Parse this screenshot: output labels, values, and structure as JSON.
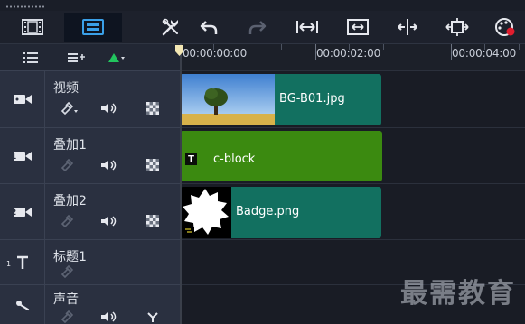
{
  "ruler": {
    "timecodes": [
      "00:00:00:00",
      "00:00:02:00",
      "00:00:04:00"
    ]
  },
  "tracks": [
    {
      "name": "视频",
      "type": "video",
      "clip": {
        "label": "BG-B01.jpg",
        "kind": "image"
      }
    },
    {
      "name": "叠加1",
      "type": "overlay",
      "badge": "1",
      "clip": {
        "label": "c-block",
        "kind": "title"
      }
    },
    {
      "name": "叠加2",
      "type": "overlay",
      "badge": "2",
      "clip": {
        "label": "Badge.png",
        "kind": "image"
      }
    },
    {
      "name": "标题1",
      "type": "title",
      "badge": "1"
    },
    {
      "name": "声音",
      "type": "voice"
    }
  ],
  "clip_icons": {
    "title_clip_glyph": "T"
  },
  "watermark": "最需教育",
  "colors": {
    "clip_video": "#127060",
    "clip_title": "#3b8a10",
    "accent_green": "#22c55e",
    "record_red": "#e11d2e"
  },
  "icons": [
    "storyboard-view-icon",
    "timeline-view-icon",
    "tools-icon",
    "undo-icon",
    "redo-icon",
    "fit-project-icon",
    "fit-window-icon",
    "split-icon",
    "track-manager-icon",
    "smart-render-icon"
  ]
}
